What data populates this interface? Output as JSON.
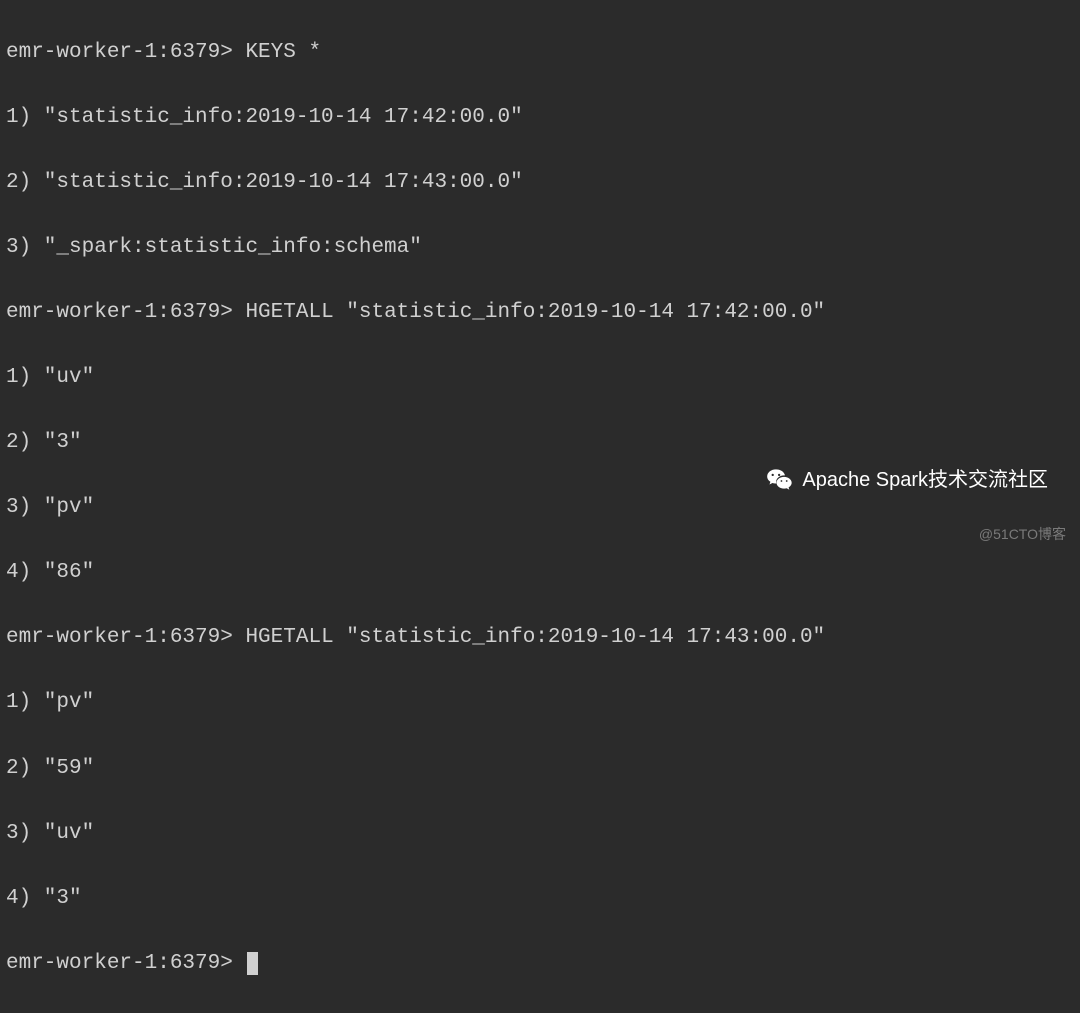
{
  "prompt": "emr-worker-1:6379>",
  "commands": {
    "cmd1": "KEYS *",
    "cmd2": "HGETALL \"statistic_info:2019-10-14 17:42:00.0\"",
    "cmd3": "HGETALL \"statistic_info:2019-10-14 17:43:00.0\""
  },
  "output1": {
    "l1": "1) \"statistic_info:2019-10-14 17:42:00.0\"",
    "l2": "2) \"statistic_info:2019-10-14 17:43:00.0\"",
    "l3": "3) \"_spark:statistic_info:schema\""
  },
  "output2": {
    "l1": "1) \"uv\"",
    "l2": "2) \"3\"",
    "l3": "3) \"pv\"",
    "l4": "4) \"86\""
  },
  "output3": {
    "l1": "1) \"pv\"",
    "l2": "2) \"59\"",
    "l3": "3) \"uv\"",
    "l4": "4) \"3\""
  },
  "watermarks": {
    "wechat": "Apache Spark技术交流社区",
    "blog": "@51CTO博客"
  }
}
